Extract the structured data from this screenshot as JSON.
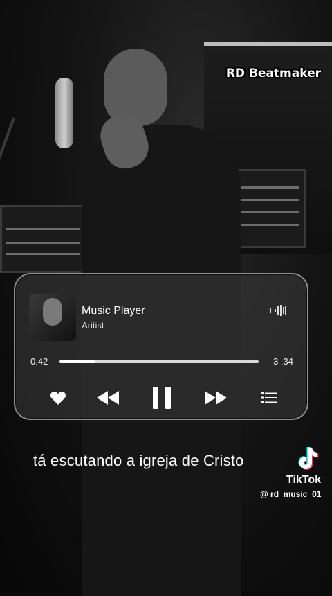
{
  "watermark": "RD Beatmaker",
  "player": {
    "title": "Music Player",
    "artist": "Aritist",
    "elapsed": "0:42",
    "remaining": "-3 :34",
    "progress_fraction": 0.18,
    "controls": {
      "like": "heart-icon",
      "previous": "rewind-icon",
      "play_pause": "pause-icon",
      "next": "fast-forward-icon",
      "playlist": "playlist-icon"
    }
  },
  "caption": "tá escutando a igreja de Cristo",
  "tiktok": {
    "brand": "TikTok",
    "handle": "@ rd_music_01_"
  }
}
